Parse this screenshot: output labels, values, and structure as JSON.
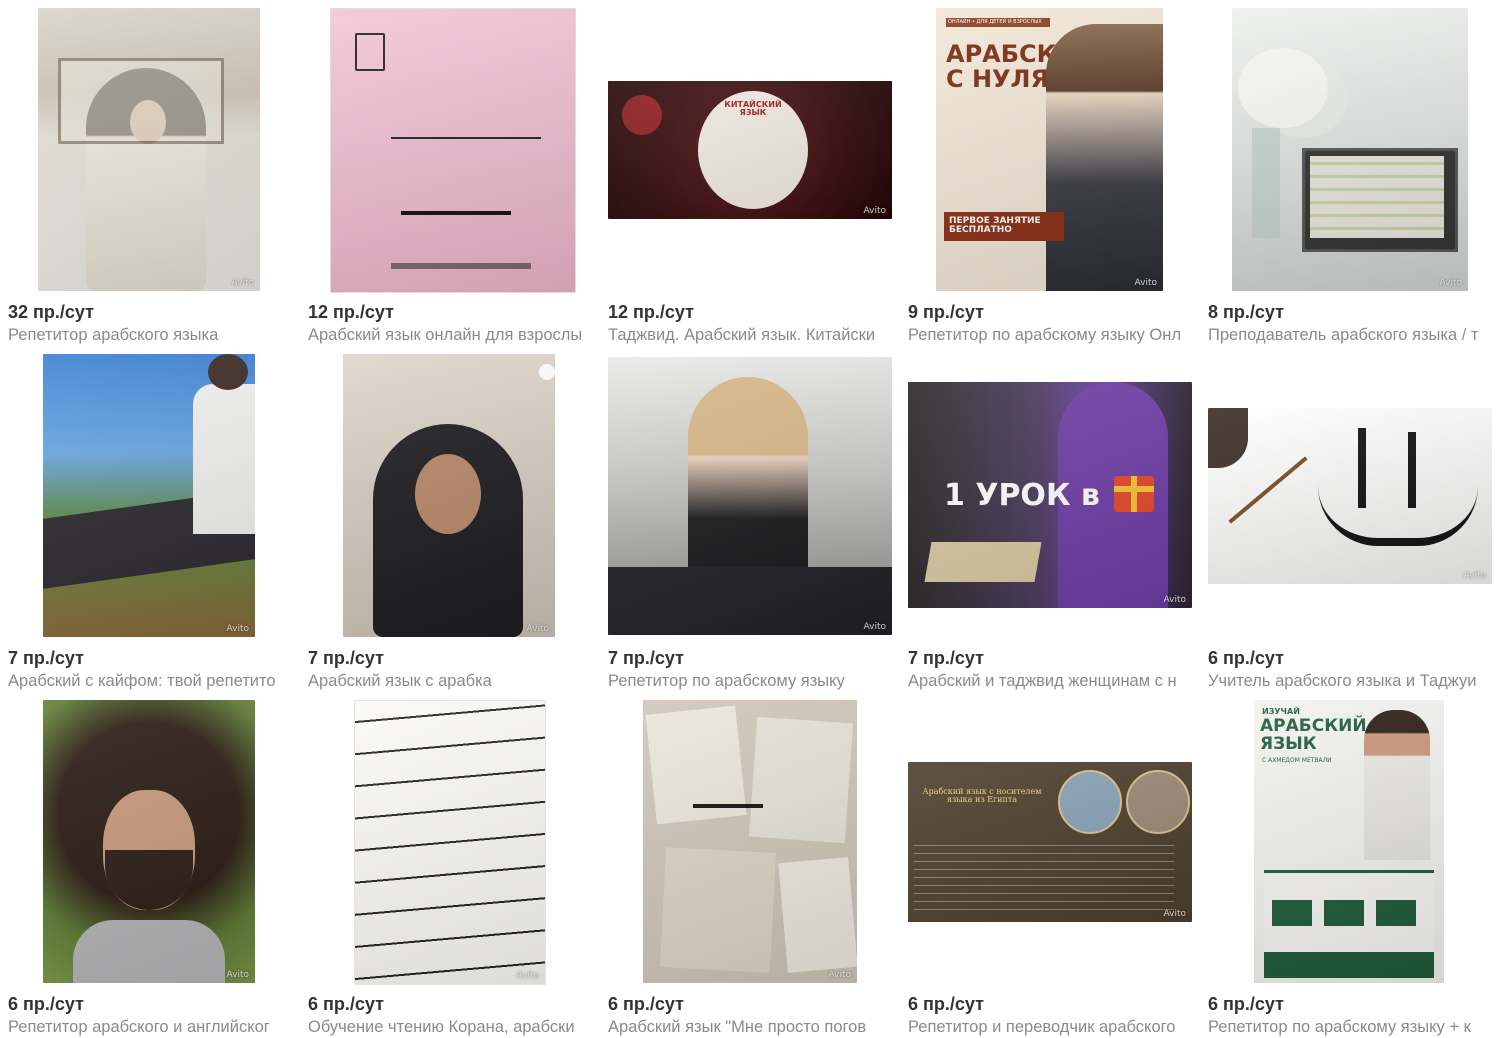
{
  "watermark": "Avito",
  "listings": [
    {
      "price": "32 пр./сут",
      "title": "Репетитор арабского языка",
      "image": "selfie-woman-white-jacket"
    },
    {
      "price": "12 пр./сут",
      "title": "Арабский язык онлайн для взрослы",
      "image": "pink-arabic-textbook-cover"
    },
    {
      "price": "12 пр./сут",
      "title": "Таджвид. Арабский язык. Китайски",
      "image": "chinese-language-banner",
      "overlay": {
        "heading": "КИТАЙСКИЙ ЯЗЫК"
      }
    },
    {
      "price": "9 пр./сут",
      "title": "Репетитор по арабскому языку Онл",
      "image": "arabic-from-zero-poster",
      "overlay": {
        "badge": "ОНЛАЙН • ДЛЯ ДЕТЕЙ И ВЗРОСЛЫХ",
        "heading": "АРАБСКИЙ С НУЛЯ",
        "free": "ПЕРВОЕ ЗАНЯТИЕ БЕСПЛАТНО"
      }
    },
    {
      "price": "8 пр./сут",
      "title": "Преподаватель арабского языка / т",
      "image": "laptop-with-flowers"
    },
    {
      "price": "7 пр./сут",
      "title": "Арабский с кайфом: твой репетито",
      "image": "man-reading-outdoors"
    },
    {
      "price": "7 пр./сут",
      "title": "Арабский язык с арабка",
      "image": "woman-in-hijab-portrait"
    },
    {
      "price": "7 пр./сут",
      "title": "Репетитор по арабскому языку",
      "image": "woman-at-table-museum"
    },
    {
      "price": "7 пр./сут",
      "title": "Арабский и таджвид женщинам с н",
      "image": "one-lesson-gift-banner",
      "overlay": {
        "heading": "1 УРОК в"
      }
    },
    {
      "price": "6 пр./сут",
      "title": "Учитель арабского языка и Таджуи",
      "image": "arabic-calligraphy-white"
    },
    {
      "price": "6 пр./сут",
      "title": "Репетитор арабского и английског",
      "image": "man-curly-hair-selfie"
    },
    {
      "price": "6 пр./сут",
      "title": "Обучение чтению Корана, арабски",
      "image": "quran-page-closeup"
    },
    {
      "price": "6 пр./сут",
      "title": "Арабский язык \"Мне просто погов",
      "image": "calligraphy-collage"
    },
    {
      "price": "6 пр./сут",
      "title": "Репетитор и переводчик арабского",
      "image": "native-speaker-egypt-banner",
      "overlay": {
        "heading": "Арабский язык с носителем языка из Египта"
      }
    },
    {
      "price": "6 пр./сут",
      "title": "Репетитор по арабскому языку + к",
      "image": "learn-arabic-akhmed-poster",
      "overlay": {
        "badge": "ИЗУЧАЙ",
        "heading": "АРАБСКИЙ ЯЗЫК",
        "sub": "С АХМЕДОМ МЕТВАЛИ"
      }
    }
  ]
}
